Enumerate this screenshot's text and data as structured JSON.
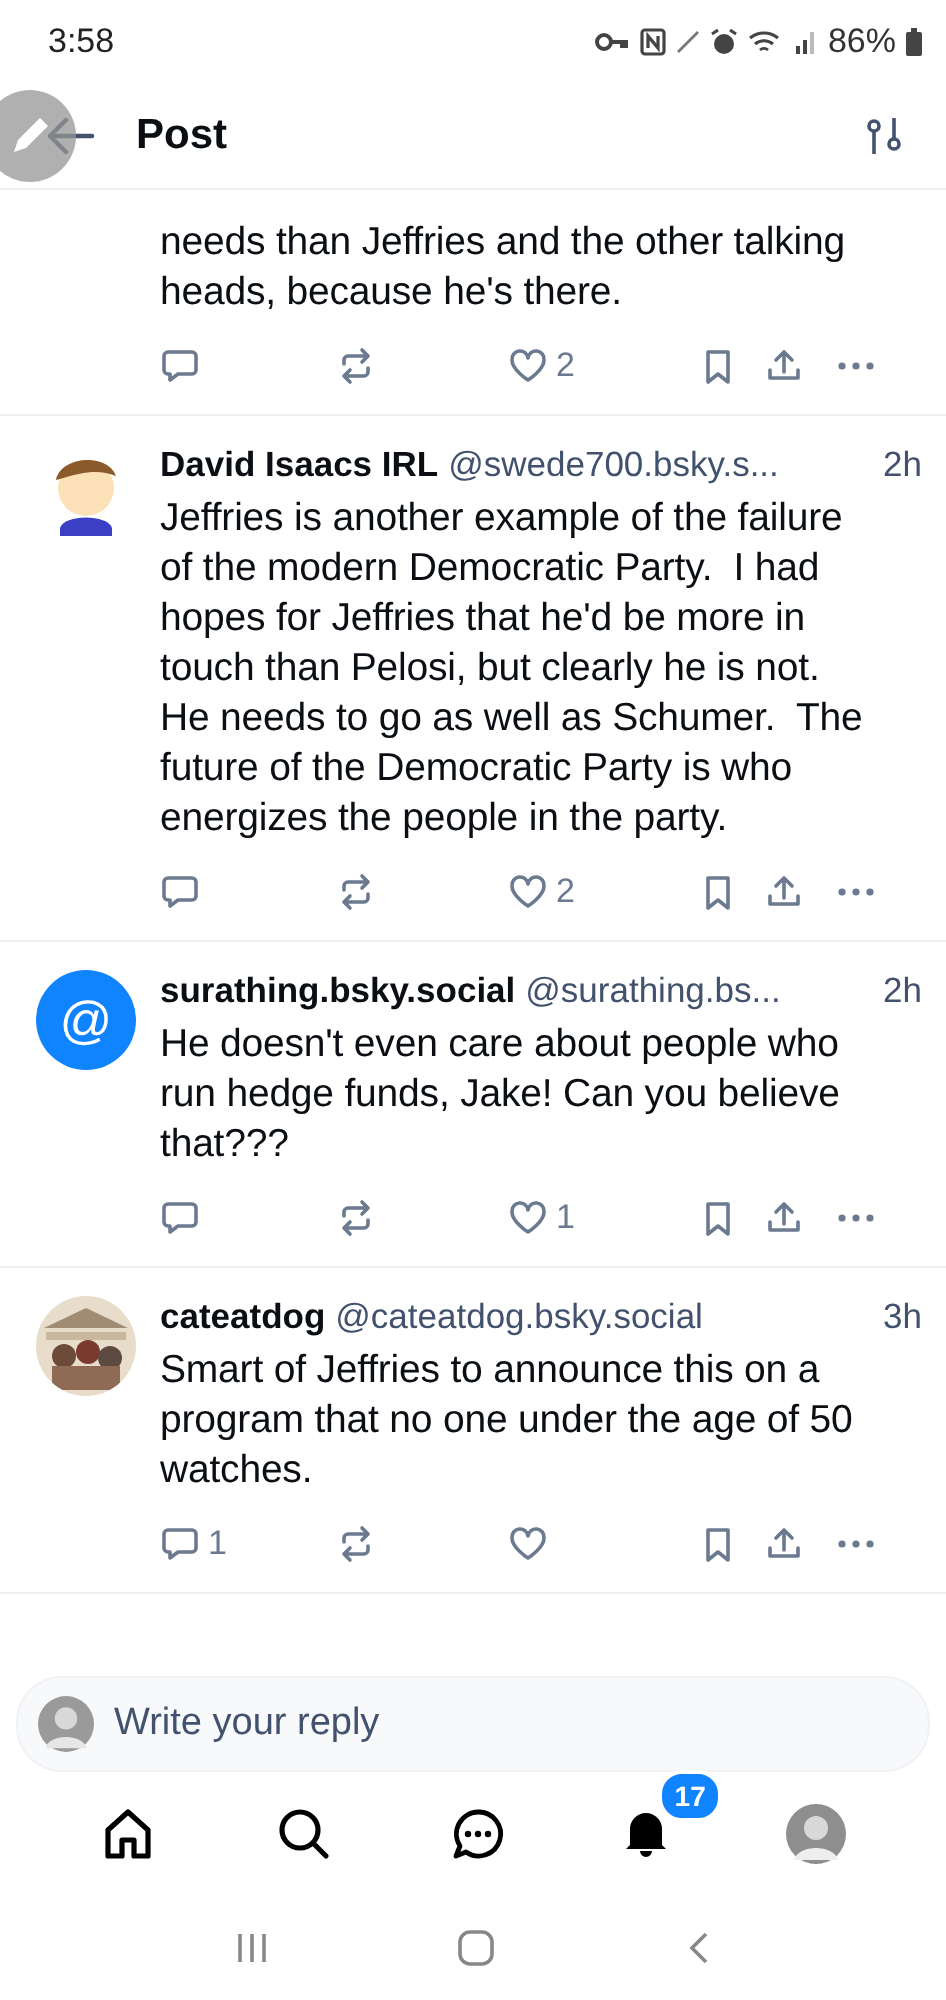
{
  "status_bar": {
    "time": "3:58",
    "battery": "86%"
  },
  "header": {
    "title": "Post"
  },
  "top_post": {
    "text": "needs than Jeffries and the other talking heads, because he's there.",
    "actions": {
      "likes": "2"
    }
  },
  "replies": [
    {
      "avatar": {
        "kind": "cartoon"
      },
      "name": "David Isaacs IRL",
      "handle": "@swede700.bsky.s...",
      "time": "2h",
      "text": "Jeffries is another example of the failure of the modern Democratic Party.  I had hopes for Jeffries that he'd be more in touch than Pelosi, but clearly he is not. He needs to go as well as Schumer.  The future of the Democratic Party is who energizes the people in the party.",
      "actions": {
        "likes": "2"
      }
    },
    {
      "avatar": {
        "kind": "at",
        "text": "@"
      },
      "name": "surathing.bsky.social",
      "handle": "@surathing.bs...",
      "time": "2h",
      "text": "He doesn't even care about people who run hedge funds, Jake! Can you believe that???",
      "actions": {
        "likes": "1"
      }
    },
    {
      "name": "cateatdog",
      "handle": "@cateatdog.bsky.social",
      "time": "3h",
      "text": "Smart of Jeffries to announce this on a program that no one under the age of 50 watches.",
      "actions": {
        "replies": "1"
      }
    }
  ],
  "reply_field": {
    "placeholder": "Write your reply"
  },
  "tab_bar": {
    "notifications_badge": "17"
  }
}
